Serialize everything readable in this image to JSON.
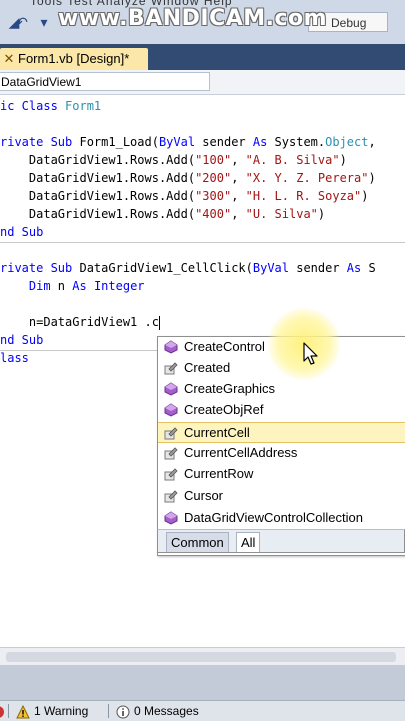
{
  "watermark": "www.BANDICAM.com",
  "toolbar": {
    "menu_hint": "Tools   Test   Analyze   Window   Help",
    "config_value": "Debug"
  },
  "tab": {
    "label": "Form1.vb [Design]*",
    "close_glyph": "✕"
  },
  "navbar": {
    "object_combo": "DataGridView1"
  },
  "code": {
    "line1": {
      "kw": "ic Class",
      "name": " Form1"
    },
    "line2": {
      "kw1": "rivate Sub",
      "t1": " Form1_Load(",
      "kw2": "ByVal",
      "t2": " sender ",
      "kw3": "As",
      "t3": " System.",
      "ty": "Object",
      "t4": ","
    },
    "rows": [
      {
        "pre": "    DataGridView1.Rows.Add(",
        "s1": "\"100\"",
        "mid": ", ",
        "s2": "\"A. B. Silva\"",
        "post": ")"
      },
      {
        "pre": "    DataGridView1.Rows.Add(",
        "s1": "\"200\"",
        "mid": ", ",
        "s2": "\"X. Y. Z. Perera\"",
        "post": ")"
      },
      {
        "pre": "    DataGridView1.Rows.Add(",
        "s1": "\"300\"",
        "mid": ", ",
        "s2": "\"H. L. R. Soyza\"",
        "post": ")"
      },
      {
        "pre": "    DataGridView1.Rows.Add(",
        "s1": "\"400\"",
        "mid": ", ",
        "s2": "\"U. Silva\"",
        "post": ")"
      }
    ],
    "end_sub1": "nd Sub",
    "line_click": {
      "kw1": "rivate Sub",
      "t1": " DataGridView1_CellClick(",
      "kw2": "ByVal",
      "t2": " sender ",
      "kw3": "As",
      "t3": " S"
    },
    "dim": {
      "kw1": "    Dim",
      "t1": " n ",
      "kw2": "As Integer"
    },
    "assign": "    n=DataGridView1 .c",
    "end_sub2": "nd Sub",
    "end_class": "lass"
  },
  "intellisense": {
    "items": [
      {
        "label": "CreateControl",
        "icon": "method-icon",
        "selected": false
      },
      {
        "label": "Created",
        "icon": "property-icon",
        "selected": false
      },
      {
        "label": "CreateGraphics",
        "icon": "method-icon",
        "selected": false
      },
      {
        "label": "CreateObjRef",
        "icon": "method-icon",
        "selected": false
      },
      {
        "label": "CurrentCell",
        "icon": "property-icon",
        "selected": true
      },
      {
        "label": "CurrentCellAddress",
        "icon": "property-icon",
        "selected": false
      },
      {
        "label": "CurrentRow",
        "icon": "property-icon",
        "selected": false
      },
      {
        "label": "Cursor",
        "icon": "property-icon",
        "selected": false
      },
      {
        "label": "DataGridViewControlCollection",
        "icon": "method-icon",
        "selected": false
      }
    ],
    "tabs": {
      "common": "Common",
      "all": "All"
    }
  },
  "errorlist": {
    "warnings": "1 Warning",
    "messages": "0 Messages"
  },
  "colors": {
    "keyword": "#0000ff",
    "string": "#a31515",
    "type": "#2b91af",
    "selection": "#fdf4bf"
  }
}
